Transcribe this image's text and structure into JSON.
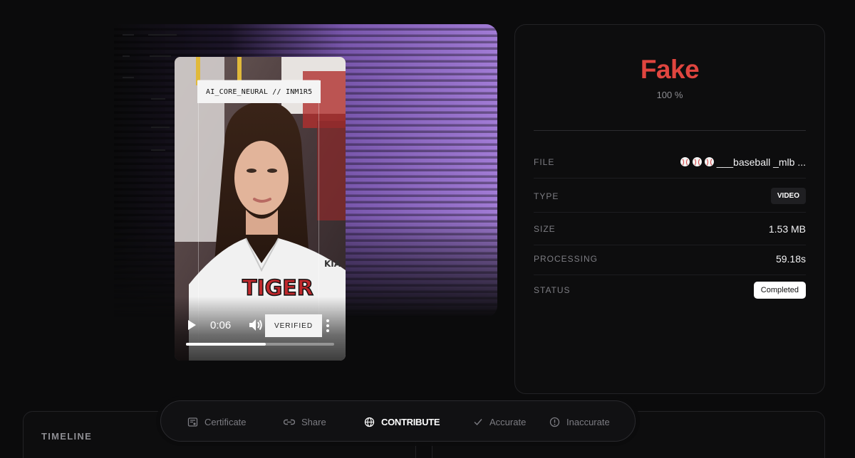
{
  "player": {
    "overlay_tag": "AI_CORE_NEURAL // INM1R5",
    "time": "0:06",
    "verified_label": "VERIFIED",
    "progress": 0.54
  },
  "result": {
    "verdict": "Fake",
    "confidence": "100 %",
    "verdict_color": "#e0453f",
    "rows": {
      "file": {
        "label": "FILE",
        "value": "___baseball _mlb ...",
        "emoji_icons": [
          "baseball-icon",
          "baseball-icon",
          "baseball-icon"
        ]
      },
      "type": {
        "label": "TYPE",
        "value": "VIDEO"
      },
      "size": {
        "label": "SIZE",
        "value": "1.53 MB"
      },
      "processing": {
        "label": "PROCESSING",
        "value": "59.18s"
      },
      "status": {
        "label": "STATUS",
        "value": "Completed"
      }
    }
  },
  "timeline": {
    "title": "TIMELINE"
  },
  "actions": [
    {
      "label": "Certificate",
      "icon": "certificate-icon"
    },
    {
      "label": "Share",
      "icon": "share-icon"
    },
    {
      "label": "CONTRIBUTE",
      "icon": "globe-icon",
      "active": true
    },
    {
      "label": "Accurate",
      "icon": "check-icon"
    },
    {
      "label": "Inaccurate",
      "icon": "alert-circle-icon"
    }
  ]
}
